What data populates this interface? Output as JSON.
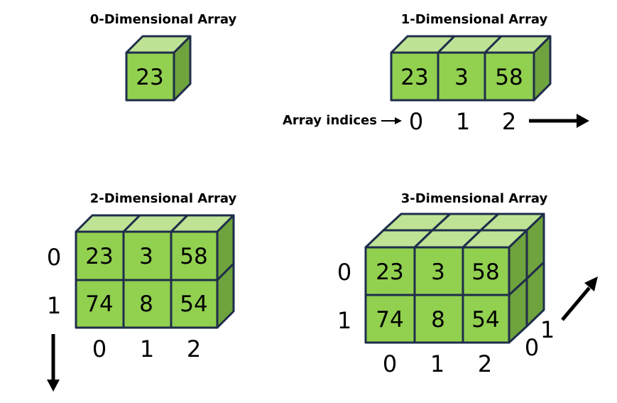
{
  "diagram": {
    "titles": {
      "zero_d": "0-Dimensional Array",
      "one_d": "1-Dimensional Array",
      "two_d": "2-Dimensional Array",
      "three_d": "3-Dimensional Array"
    },
    "zero_d": {
      "value": "23"
    },
    "one_d": {
      "values": [
        "23",
        "3",
        "58"
      ],
      "indices_label": "Array indices",
      "indices": [
        "0",
        "1",
        "2"
      ]
    },
    "two_d": {
      "rows": [
        [
          "23",
          "3",
          "58"
        ],
        [
          "74",
          "8",
          "54"
        ]
      ],
      "row_indices": [
        "0",
        "1"
      ],
      "col_indices": [
        "0",
        "1",
        "2"
      ]
    },
    "three_d": {
      "rows": [
        [
          "23",
          "3",
          "58"
        ],
        [
          "74",
          "8",
          "54"
        ]
      ],
      "row_indices": [
        "0",
        "1"
      ],
      "col_indices": [
        "0",
        "1",
        "2"
      ],
      "depth_indices": [
        "0",
        "1"
      ]
    },
    "colors": {
      "cube_front": "#92D050",
      "cube_top": "#BEE395",
      "cube_side": "#6FA33D",
      "cube_outline": "#1F2D4B"
    }
  }
}
